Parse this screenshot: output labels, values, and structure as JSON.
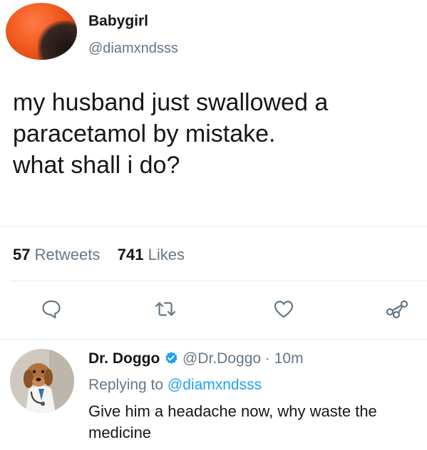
{
  "tweet": {
    "display_name": "Babygirl",
    "handle": "@diamxndsss",
    "text_lines": [
      "my husband just swallowed a",
      "paracetamol by mistake.",
      "what shall i do?"
    ]
  },
  "stats": {
    "retweets_count": "57",
    "retweets_label": "Retweets",
    "likes_count": "741",
    "likes_label": "Likes"
  },
  "actions": {
    "reply_icon": "speech-bubble-icon",
    "retweet_icon": "retweet-icon",
    "like_icon": "heart-icon",
    "share_icon": "share-icon"
  },
  "reply": {
    "display_name": "Dr. Doggo",
    "handle": "@Dr.Doggo",
    "separator": "·",
    "time": "10m",
    "replying_prefix": "Replying to",
    "replying_handle": "@diamxndsss",
    "text": "Give him a headache now, why waste the medicine"
  },
  "colors": {
    "primary_text": "#14171a",
    "secondary_text": "#657786",
    "link": "#1da1f2",
    "verified": "#1da1f2",
    "divider": "#e6ecf0"
  }
}
